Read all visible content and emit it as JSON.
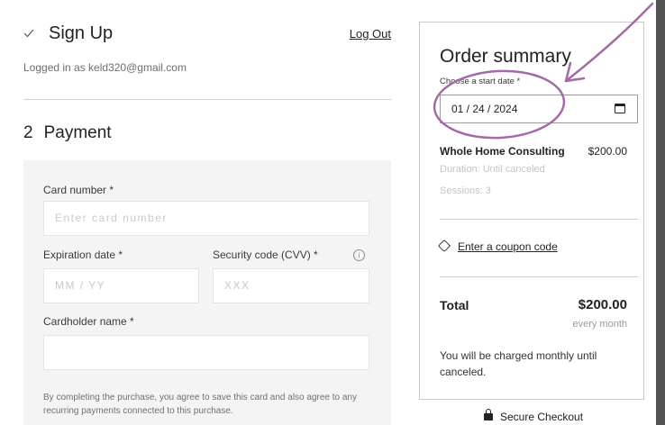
{
  "signup": {
    "title": "Sign Up",
    "logout_label": "Log Out",
    "logged_in_text": "Logged in as keld320@gmail.com"
  },
  "payment": {
    "step_number": "2",
    "heading": "Payment",
    "card_number_label": "Card number *",
    "card_number_placeholder": "Enter card number",
    "expiration_label": "Expiration date *",
    "expiration_placeholder": "MM / YY",
    "cvv_label": "Security code (CVV) *",
    "cvv_placeholder": "XXX",
    "cardholder_label": "Cardholder name *",
    "cardholder_value": "",
    "fine_print": "By completing the purchase, you agree to save this card and also agree to any recurring payments connected to this purchase."
  },
  "summary": {
    "title": "Order summary",
    "start_date_label": "Choose a start date *",
    "start_date_value": "01 / 24 / 2024",
    "product_name": "Whole Home Consulting",
    "product_price": "$200.00",
    "duration": "Duration: Until canceled",
    "sessions": "Sessions: 3",
    "coupon_label": "Enter a coupon code",
    "total_label": "Total",
    "total_value": "$200.00",
    "total_period": "every month",
    "charge_note": "You will be charged monthly until canceled.",
    "secure_label": "Secure Checkout"
  },
  "icons": {
    "signup": "checkmark-icon",
    "info": "info-icon",
    "calendar": "calendar-icon",
    "coupon": "tag-icon",
    "secure": "lock-icon"
  },
  "colors": {
    "annotation": "#a46aa6",
    "background": "#525252"
  }
}
